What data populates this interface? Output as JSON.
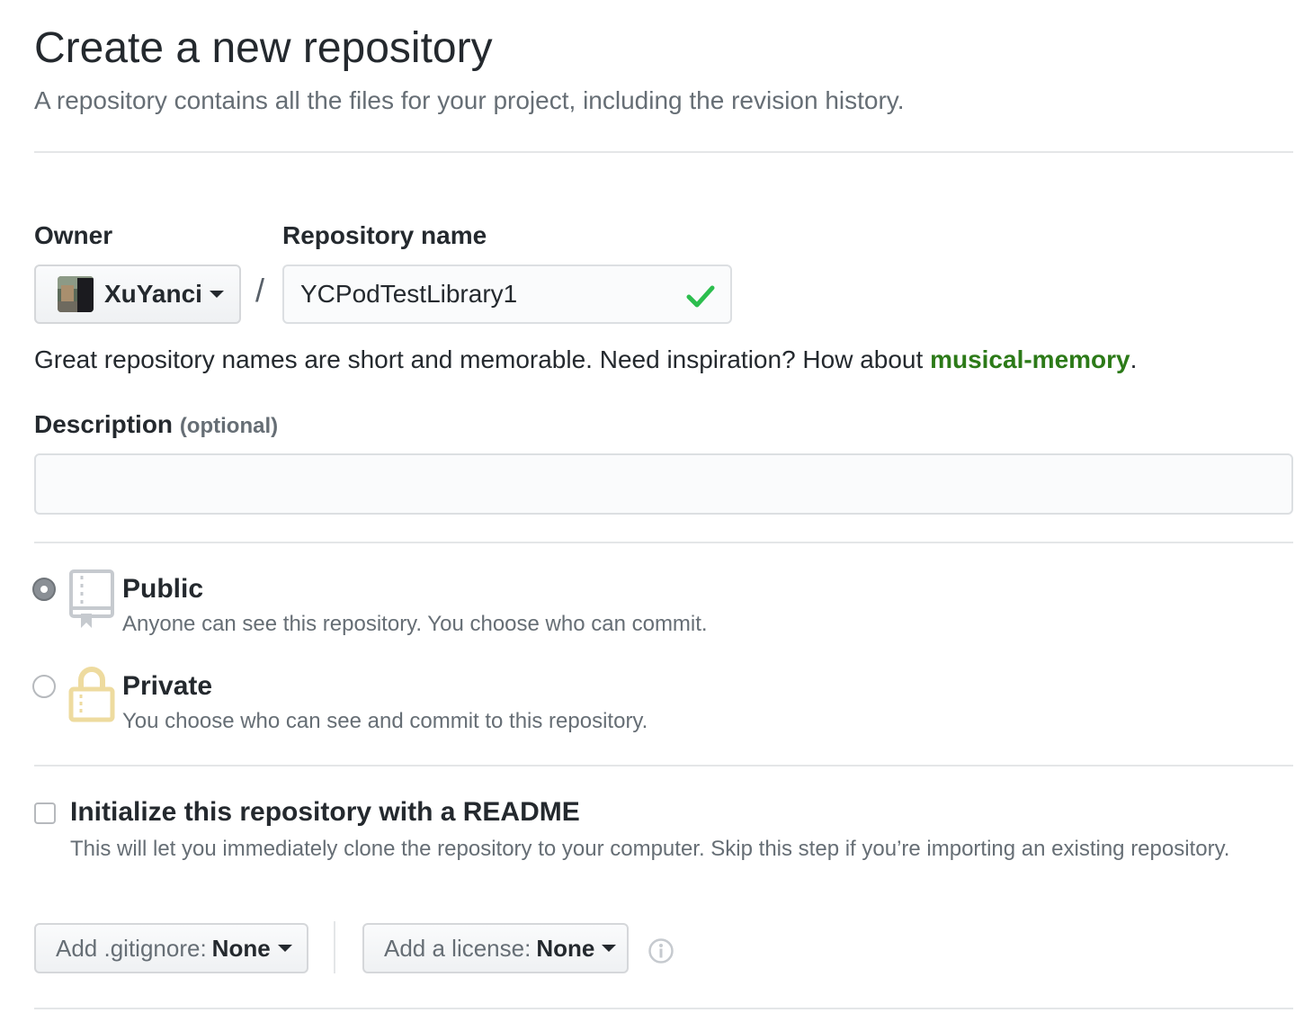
{
  "header": {
    "title": "Create a new repository",
    "subtitle": "A repository contains all the files for your project, including the revision history."
  },
  "owner": {
    "label": "Owner",
    "name": "XuYanci",
    "avatar_icon": "user-avatar",
    "caret_icon": "caret-down-icon"
  },
  "separator": "/",
  "repo_name": {
    "label": "Repository name",
    "value": "YCPodTestLibrary1",
    "valid_icon": "check-icon",
    "valid_color": "#2cbe4e"
  },
  "hint": {
    "text": "Great repository names are short and memorable. Need inspiration? How about ",
    "suggestion": "musical-memory",
    "suffix": ".",
    "suggestion_color": "#2c7a18"
  },
  "description": {
    "label": "Description",
    "optional": "(optional)",
    "value": "",
    "placeholder": ""
  },
  "visibility": {
    "selected": "public",
    "options": [
      {
        "id": "public",
        "title": "Public",
        "desc": "Anyone can see this repository. You choose who can commit.",
        "icon": "repo-book-icon"
      },
      {
        "id": "private",
        "title": "Private",
        "desc": "You choose who can see and commit to this repository.",
        "icon": "lock-icon"
      }
    ]
  },
  "readme": {
    "checked": false,
    "title": "Initialize this repository with a README",
    "desc": "This will let you immediately clone the repository to your computer. Skip this step if you’re importing an existing repository."
  },
  "gitignore": {
    "prefix": "Add .gitignore:",
    "value": "None"
  },
  "license": {
    "prefix": "Add a license:",
    "value": "None"
  },
  "info_icon": "info-icon",
  "colors": {
    "accent_green": "#2c7a18",
    "border": "#e1e4e8",
    "muted_text": "#666e75"
  }
}
